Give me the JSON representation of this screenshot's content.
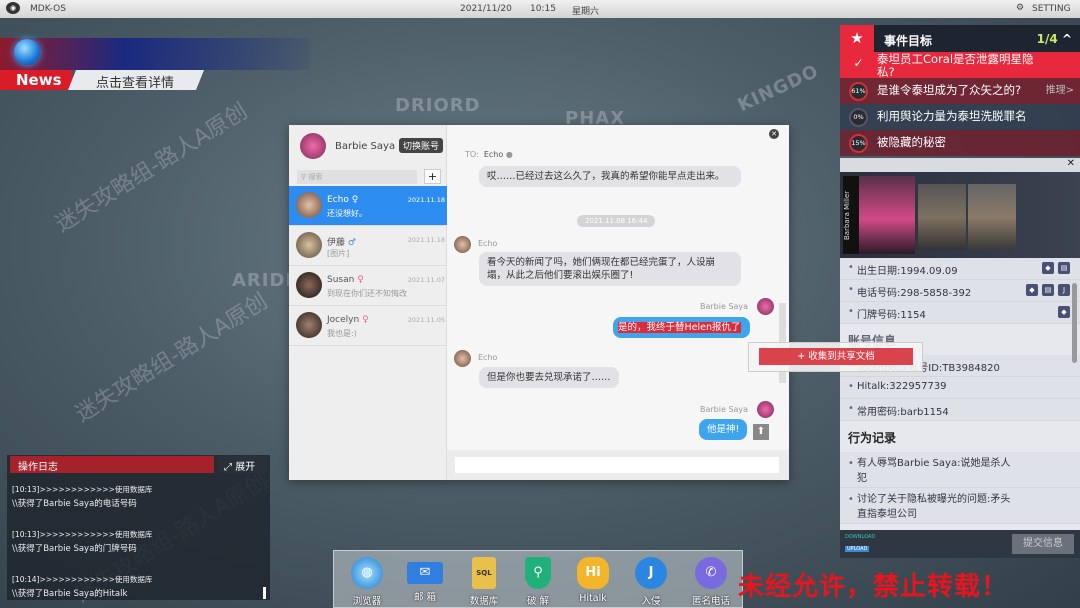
{
  "topbar": {
    "os": "MDK-OS",
    "date": "2021/11/20",
    "time": "10:15",
    "weekday": "星期六",
    "setting": "SETTING"
  },
  "map": {
    "labels": [
      "DRIORD",
      "PHAX",
      "ARIDI",
      "KINGDO"
    ]
  },
  "news": {
    "tag": "News",
    "link": "点击查看详情"
  },
  "events": {
    "title": "事件目标",
    "count": "1/4",
    "items": [
      {
        "badge": "✓",
        "text": "泰坦员工Coral是否泄露明星隐私?"
      },
      {
        "badge": "61%",
        "text": "是谁令泰坦成为了众矢之的?",
        "action": "推理>"
      },
      {
        "badge": "0%",
        "text": "利用舆论力量为泰坦洗脱罪名"
      },
      {
        "badge": "15%",
        "text": "被隐藏的秘密"
      }
    ]
  },
  "profile": {
    "name_tag": "Barbara Miller",
    "rows": [
      {
        "text": "出生日期:1994.09.09"
      },
      {
        "text": "电话号码:298-5858-392"
      },
      {
        "text": "门牌号码:1154"
      }
    ],
    "account_section": "账号信息",
    "account_rows": [
      {
        "text": "Toothbook账号ID:TB3984820"
      },
      {
        "text": "Hitalk:322957739"
      },
      {
        "text": "常用密码:barb1154"
      }
    ],
    "behavior_section": "行为记录",
    "behavior_rows": [
      {
        "text": "有人辱骂Barbie Saya:说她是杀人犯"
      },
      {
        "text": "讨论了关于隐私被曝光的问题:矛头直指泰坦公司"
      }
    ],
    "download": "DOWNLOAD",
    "upload": "UPLOAD",
    "submit": "提交信息"
  },
  "chat": {
    "user": "Barbie Saya",
    "switch": "切换账号",
    "search_placeholder": "搜索",
    "add": "+",
    "contacts": [
      {
        "name": "Echo",
        "gender": "♀",
        "date": "2021.11.18",
        "msg": "还没想好。"
      },
      {
        "name": "伊藤",
        "gender": "♂",
        "date": "2021.11.18",
        "msg": "[图片]"
      },
      {
        "name": "Susan",
        "gender": "♀",
        "date": "2021.11.07",
        "msg": "到现在你们还不知悔改"
      },
      {
        "name": "Jocelyn",
        "gender": "♀",
        "date": "2021.11.05",
        "msg": "我也是:)"
      }
    ],
    "to_label": "TO:",
    "to_name": "Echo",
    "messages": [
      {
        "text": "哎……已经过去这么久了，我真的希望你能早点走出来。"
      },
      {
        "time": "2021.11.08  16:44"
      },
      {
        "sender": "Echo",
        "text": "看今天的新闻了吗，她们俩现在都已经完蛋了，人设崩塌，从此之后他们要滚出娱乐圈了!"
      },
      {
        "sender": "Barbie Saya",
        "text": "是的，我终于替Helen报仇了"
      },
      {
        "sender": "Echo",
        "text": "但是你也要去兑现承诺了……"
      },
      {
        "sender": "Barbie Saya",
        "text": "他是神!"
      }
    ],
    "context_menu": "+ 收集到共享文档"
  },
  "log": {
    "title": "操作日志",
    "expand": "展开",
    "lines": [
      "[10:13]>>>>>>>>>>>>使用数据库",
      "\\\\获得了Barbie Saya的电话号码",
      "",
      "[10:13]>>>>>>>>>>>>使用数据库",
      "\\\\获得了Barbie Saya的门牌号码",
      "",
      "[10:14]>>>>>>>>>>>>使用数据库",
      "\\\\获得了Barbie Saya的Hitalk"
    ]
  },
  "dock": [
    {
      "label": "浏览器"
    },
    {
      "label": "邮 箱"
    },
    {
      "label": "数据库"
    },
    {
      "label": "破 解"
    },
    {
      "label": "Hitalk"
    },
    {
      "label": "入侵"
    },
    {
      "label": "匿名电话"
    }
  ],
  "watermark": {
    "warning": "未经允许，禁止转载！",
    "overlay": "迷失攻略组-路人A原创"
  },
  "colors": {
    "accent": "#e8283c",
    "chat_blue": "#3ea5ec",
    "selected": "#2d8cf0"
  }
}
